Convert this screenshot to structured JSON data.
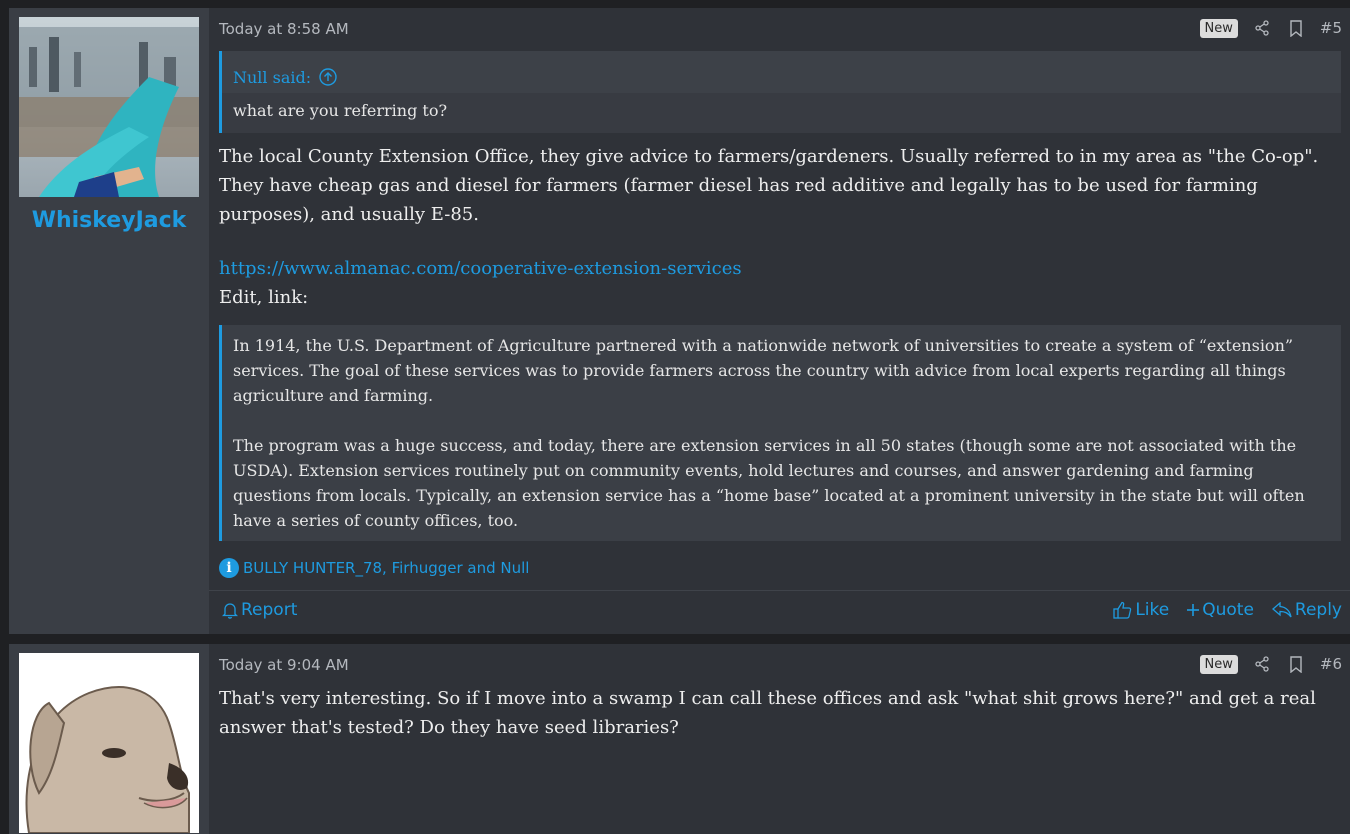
{
  "posts": [
    {
      "author": "WhiskeyJack",
      "time": "Today at 8:58 AM",
      "badge": "New",
      "number": "#5",
      "quote": {
        "author": "Null said:",
        "text": "what are you referring to?"
      },
      "message": "The local County Extension Office, they give advice to farmers/gardeners. Usually referred to in my area as \"the Co-op\". They have cheap gas and diesel for farmers (farmer diesel has red additive and legally has to be used for farming purposes), and usually E-85.",
      "link": "https://www.almanac.com/cooperative-extension-services",
      "edit_text": "Edit, link:",
      "excerpt": {
        "p1": "In 1914, the U.S. Department of Agriculture partnered with a nationwide network of universities to create a system of “extension” services. The goal of these services was to provide farmers across the country with advice from local experts regarding all things agriculture and farming.",
        "p2": "The program was a huge success, and today, there are extension services in all 50 states (though some are not associated with the USDA). Extension services routinely put on community events, hold lectures and courses, and answer gardening and farming questions from locals. Typically, an extension service has a “home base” located at a prominent university in the state but will often have a series of county offices, too."
      },
      "reactions": "BULLY HUNTER_78, Firhugger and Null",
      "actions": {
        "report": "Report",
        "like": "Like",
        "quote": "Quote",
        "reply": "Reply"
      }
    },
    {
      "time": "Today at 9:04 AM",
      "badge": "New",
      "number": "#6",
      "message": "That's very interesting. So if I move into a swamp I can call these offices and ask \"what shit grows here?\" and get a real answer that's tested? Do they have seed libraries?"
    }
  ],
  "colors": {
    "accent": "#1e9be0",
    "post_bg": "#2f3238",
    "user_bg": "#3a3e45",
    "quote_bg": "#3b3f46"
  },
  "icons": [
    "share-icon",
    "bookmark-icon",
    "arrow-up-circle-icon",
    "info-icon",
    "bell-icon",
    "thumbs-up-icon",
    "plus-icon",
    "reply-icon"
  ]
}
